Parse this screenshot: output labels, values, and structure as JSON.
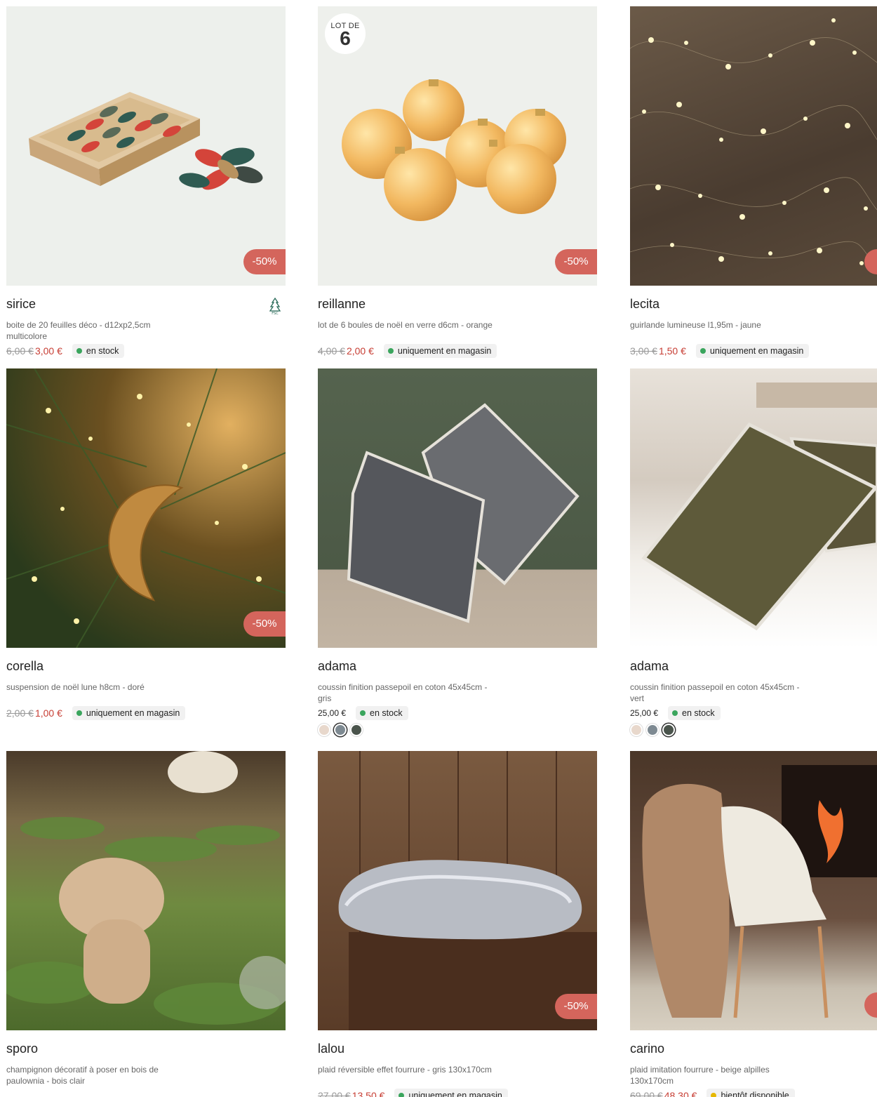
{
  "products": [
    {
      "name": "sirice",
      "desc": "boite de 20 feuilles déco - d12xp2,5cm multicolore",
      "old_price": "6,00 €",
      "price": "3,00 €",
      "stock": "en stock",
      "discount": "-50%"
    },
    {
      "name": "reillanne",
      "desc": "lot de 6 boules de noël en verre d6cm - orange",
      "old_price": "4,00 €",
      "price": "2,00 €",
      "stock": "uniquement en magasin",
      "discount": "-50%",
      "lot_top": "LOT DE",
      "lot_num": "6"
    },
    {
      "name": "lecita",
      "desc": "guirlande lumineuse l1,95m - jaune",
      "old_price": "3,00 €",
      "price": "1,50 €",
      "stock": "uniquement en magasin"
    },
    {
      "name": "corella",
      "desc": "suspension de noël lune h8cm - doré",
      "old_price": "2,00 €",
      "price": "1,00 €",
      "stock": "uniquement en magasin",
      "discount": "-50%"
    },
    {
      "name": "adama",
      "desc": "coussin finition passepoil en coton 45x45cm - gris",
      "price": "25,00 €",
      "stock": "en stock"
    },
    {
      "name": "adama",
      "desc": "coussin finition passepoil en coton 45x45cm - vert",
      "price": "25,00 €",
      "stock": "en stock"
    },
    {
      "name": "sporo",
      "desc": "champignon décoratif à poser en bois de paulownia - bois clair"
    },
    {
      "name": "lalou",
      "desc": "plaid réversible effet fourrure - gris 130x170cm",
      "old_price": "27,00 €",
      "price": "13,50 €",
      "stock": "uniquement en magasin",
      "discount": "-50%"
    },
    {
      "name": "carino",
      "desc": "plaid imitation fourrure - beige alpilles 130x170cm",
      "old_price": "69,00 €",
      "price": "48,30 €",
      "stock": "bientôt disponible"
    }
  ],
  "swatch_colors": {
    "gris": [
      "#e8d8cc",
      "#7e8a92",
      "#4a544c"
    ],
    "vert": [
      "#e8d8cc",
      "#7e8a92",
      "#4a544c"
    ]
  },
  "colors": {
    "discount": "#d4655c",
    "sale_price": "#c73e34",
    "in_stock": "#3aa55d",
    "soon": "#e6b800"
  }
}
